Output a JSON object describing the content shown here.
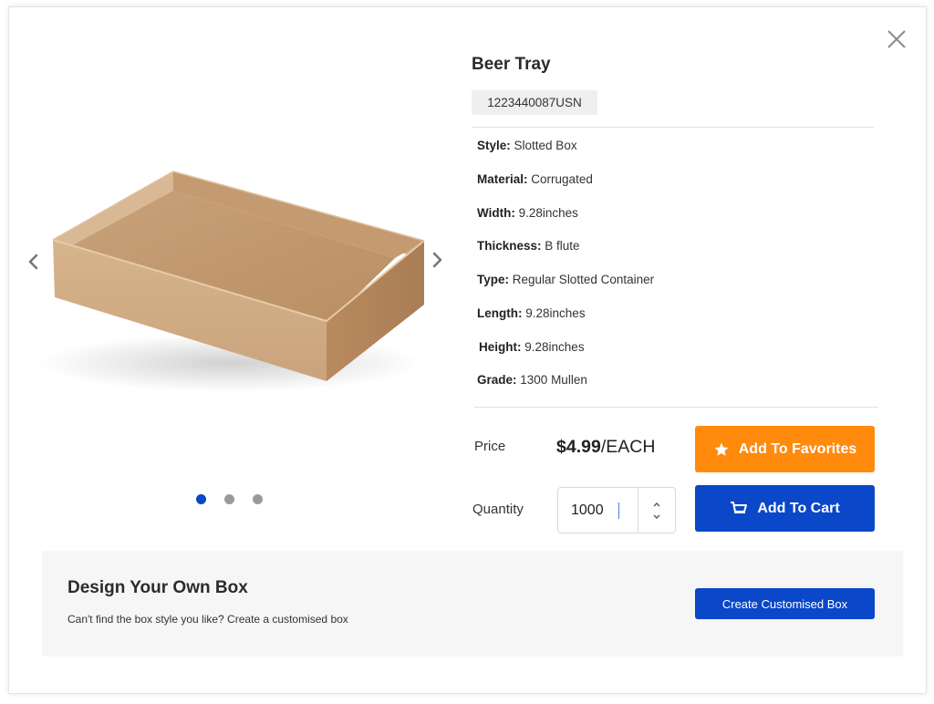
{
  "product": {
    "title": "Beer Tray",
    "sku": "1223440087USN",
    "image": "cardboard-tray-image"
  },
  "specs": [
    {
      "label": "Style:",
      "value": "Slotted Box"
    },
    {
      "label": "Material:",
      "value": "Corrugated"
    },
    {
      "label": "Width:",
      "value": "9.28inches"
    },
    {
      "label": "Thickness:",
      "value": "B flute"
    },
    {
      "label": "Type:",
      "value": "Regular Slotted Container"
    },
    {
      "label": "Length:",
      "value": "9.28inches"
    },
    {
      "label": "Height:",
      "value": "9.28inches"
    },
    {
      "label": "Grade:",
      "value": "1300 Mullen"
    }
  ],
  "gallery": {
    "slide_count": 3,
    "active_index": 0
  },
  "purchase": {
    "price_label": "Price",
    "price_amount": "$4.99",
    "price_unit": "/EACH",
    "quantity_label": "Quantity",
    "quantity_value": "1000",
    "favorites_label": "Add To Favorites",
    "cart_label": "Add To Cart"
  },
  "design": {
    "title": "Design Your Own Box",
    "subtitle": "Can't find the box style you like? Create a customised box",
    "button_label": "Create Customised Box"
  },
  "colors": {
    "primary": "#0a47c9",
    "accent": "#ff8a0c",
    "dot_inactive": "#9a9a9a",
    "panel_bg": "#f6f6f6"
  },
  "icons": {
    "close": "close-icon",
    "prev": "chevron-left-icon",
    "next": "chevron-right-icon",
    "favorite": "star-icon",
    "cart": "cart-icon",
    "increment": "chevron-up-icon",
    "decrement": "chevron-down-icon"
  }
}
